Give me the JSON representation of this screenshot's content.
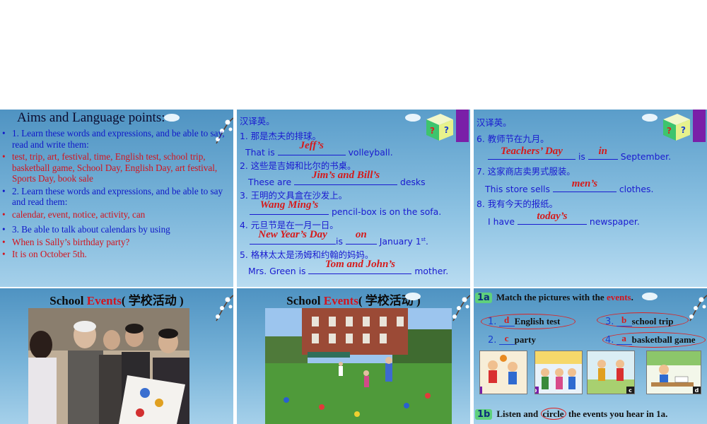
{
  "slide1": {
    "title": "Aims and Language points:",
    "items": [
      {
        "bullet": "•",
        "color": "blue",
        "text": "1. Learn these words and expressions, and be able to say, read and write them:"
      },
      {
        "bullet": "•",
        "color": "red",
        "text": "test, trip, art, festival, time, English test, school trip, basketball game, School Day, English Day, art festival, Sports Day, book sale"
      },
      {
        "bullet": "•",
        "color": "blue",
        "text": "2.  Learn these words and expressions, and be able to say and read them:"
      },
      {
        "bullet": "•",
        "color": "red",
        "text": "calendar, event, notice, activity, can"
      },
      {
        "bullet": "•",
        "color": "blue",
        "text": " 3. Be able to talk about calendars by using"
      },
      {
        "bullet": "•",
        "color": "red",
        "text": "When is Sally’s birthday party?"
      },
      {
        "bullet": "•",
        "color": "red",
        "text": "It is on October 5th."
      }
    ]
  },
  "slide2": {
    "header": "汉译英。",
    "q1": "1.  那是杰夫的排球。",
    "q1_pre": "That is ",
    "q1_ans": "Jeff’s",
    "q1_post": " volleyball.",
    "q2": "2.  这些是吉姆和比尔的书桌。",
    "q2_pre": "These are ",
    "q2_ans": "Jim’s and Bill’s",
    "q2_post": " desks",
    "q3": "3.  王明的文具盒在沙发上。",
    "q3_ans": "Wang Ming’s",
    "q3_post": " pencil-box is on the sofa.",
    "q4": "4.  元旦节是在一月一日。",
    "q4_ans1": "New Year’s Day",
    "q4_mid": "is ",
    "q4_ans2": "on",
    "q4_post": " January 1",
    "q4_sup": "st",
    "q4_end": ".",
    "q5": "5.  格林太太是汤姆和约翰的妈妈。",
    "q5_pre": "Mrs. Green is ",
    "q5_ans": "Tom and John’s",
    "q5_post": " mother."
  },
  "slide3": {
    "header": "汉译英。",
    "q6": "6.  教师节在九月。",
    "q6_ans1": "Teachers’ Day",
    "q6_mid": " is ",
    "q6_ans2": "in",
    "q6_post": " September.",
    "q7": "7.  这家商店卖男式服装。",
    "q7_pre": "This store sells ",
    "q7_ans": "men’s",
    "q7_post": " clothes.",
    "q8": "8.  我有今天的报纸。",
    "q8_pre": "I have ",
    "q8_ans": "today’s",
    "q8_post": " newspaper."
  },
  "slide4": {
    "title_pre": "School ",
    "title_red": "Events",
    "title_post": "( 学校活动 )"
  },
  "slide5": {
    "title_pre": "School ",
    "title_red": "Events",
    "title_post": "( 学校活动 )"
  },
  "slide6": {
    "badge1": "1a",
    "head1_pre": "Match the pictures with the ",
    "head1_red": "events",
    "head1_post": ".",
    "pairs": [
      {
        "num": "1.",
        "ans": "d",
        "label": "English test"
      },
      {
        "num": "3.",
        "ans": "b",
        "label": "school trip"
      },
      {
        "num": "2.",
        "ans": "c",
        "label": "party"
      },
      {
        "num": "4.",
        "ans": "a",
        "label": "basketball game"
      }
    ],
    "pic_tags": [
      "a",
      "b",
      "c",
      "d"
    ],
    "badge2": "1b",
    "head2_pre": "Listen and ",
    "head2_circle": "circle",
    "head2_post": " the events you hear in 1a."
  },
  "colors": {
    "blue_text": "#1018c8",
    "red_text": "#d2141e",
    "badge_green": "#5fd07c"
  }
}
